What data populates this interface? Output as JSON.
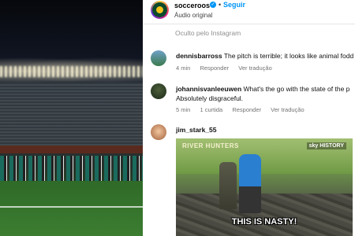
{
  "post": {
    "username": "socceroos",
    "follow_label": "Seguir",
    "subtitle": "Áudio original",
    "hidden_note": "Oculto pelo Instagram"
  },
  "comments": [
    {
      "username": "dennisbarross",
      "text": "The pitch is terrible; it looks like animal fodd",
      "time": "4 min",
      "reply": "Responder",
      "translate": "Ver tradução"
    },
    {
      "username": "johannisvanleeuwen",
      "text": "What's the go with the state of the p",
      "text2": "Absolutely disgraceful.",
      "time": "5 min",
      "likes": "1 curtida",
      "reply": "Responder",
      "translate": "Ver tradução"
    },
    {
      "username": "jim_stark_55",
      "video": {
        "logo": "RIVER HUNTERS",
        "channel": "sky HISTORY",
        "caption": "THIS IS NASTY!"
      }
    }
  ]
}
